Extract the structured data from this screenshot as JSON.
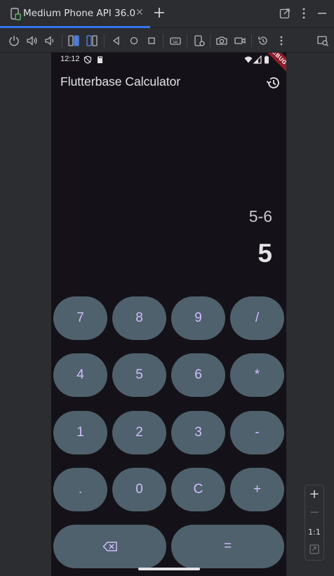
{
  "ide": {
    "tab_title": "Medium Phone API 36.0",
    "tab_close": "✕",
    "new_tab": "+"
  },
  "toolbar": {
    "icons": [
      "power-icon",
      "volume-up-icon",
      "volume-down-icon",
      "rotate-left-icon",
      "rotate-right-icon",
      "back-icon",
      "home-icon",
      "overview-icon",
      "keyboard-icon",
      "device-settings-icon",
      "screenshot-icon",
      "screen-record-icon",
      "snapshot-icon",
      "more-icon",
      "extended-controls-icon"
    ]
  },
  "zoom": {
    "zoom_in": "+",
    "zoom_out": "−",
    "actual_size": "1:1"
  },
  "phone": {
    "status_time": "12:12",
    "debug_banner": "DEBUG",
    "app_title": "Flutterbase Calculator",
    "expression": "5-6",
    "result": "5",
    "keys": {
      "k7": "7",
      "k8": "8",
      "k9": "9",
      "div": "/",
      "k4": "4",
      "k5": "5",
      "k6": "6",
      "mul": "*",
      "k1": "1",
      "k2": "2",
      "k3": "3",
      "sub": "-",
      "dot": ".",
      "k0": "0",
      "clear": "C",
      "add": "+",
      "equals": "="
    }
  },
  "colors": {
    "accent": "#3574f0",
    "key_bg": "#4f616c",
    "key_text": "#d0bcff",
    "screen_bg": "#141218"
  }
}
